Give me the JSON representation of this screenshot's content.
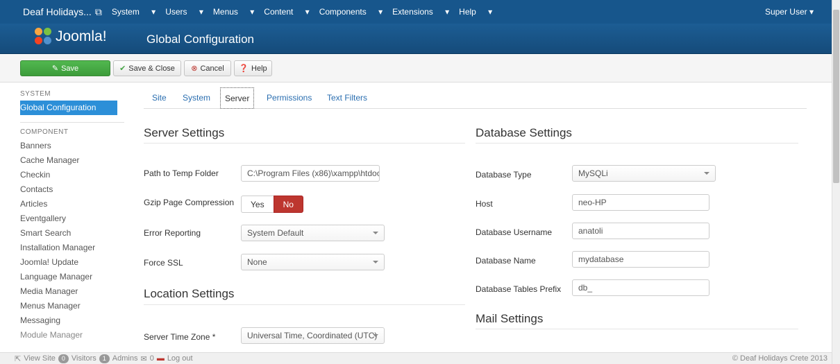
{
  "nav": {
    "site": "Deaf Holidays...",
    "menus": [
      "System",
      "Users",
      "Menus",
      "Content",
      "Components",
      "Extensions",
      "Help"
    ],
    "user": "Super User"
  },
  "header": {
    "logo_text": "Joomla!",
    "title": "Global Configuration"
  },
  "toolbar": {
    "save": "Save",
    "save_close": "Save & Close",
    "cancel": "Cancel",
    "help": "Help"
  },
  "sidebar": {
    "system_heading": "SYSTEM",
    "system_item": "Global Configuration",
    "component_heading": "COMPONENT",
    "components": [
      "Banners",
      "Cache Manager",
      "Checkin",
      "Contacts",
      "Articles",
      "Eventgallery",
      "Smart Search",
      "Installation Manager",
      "Joomla! Update",
      "Language Manager",
      "Media Manager",
      "Menus Manager",
      "Messaging",
      "Module Manager"
    ]
  },
  "tabs": [
    "Site",
    "System",
    "Server",
    "Permissions",
    "Text Filters"
  ],
  "server": {
    "heading": "Server Settings",
    "temp_label": "Path to Temp Folder",
    "temp_value": "C:\\Program Files (x86)\\xampp\\htdoc",
    "gzip_label": "Gzip Page Compression",
    "gzip_yes": "Yes",
    "gzip_no": "No",
    "error_label": "Error Reporting",
    "error_value": "System Default",
    "ssl_label": "Force SSL",
    "ssl_value": "None"
  },
  "location": {
    "heading": "Location Settings",
    "tz_label": "Server Time Zone *",
    "tz_value": "Universal Time, Coordinated (UTC)"
  },
  "database": {
    "heading": "Database Settings",
    "type_label": "Database Type",
    "type_value": "MySQLi",
    "host_label": "Host",
    "host_value": "neo-HP",
    "user_label": "Database Username",
    "user_value": "anatoli",
    "name_label": "Database Name",
    "name_value": "mydatabase",
    "prefix_label": "Database Tables Prefix",
    "prefix_value": "db_"
  },
  "mail": {
    "heading": "Mail Settings"
  },
  "status": {
    "view_site": "View Site",
    "visitors_count": "0",
    "visitors": "Visitors",
    "admins_count": "1",
    "admins": "Admins",
    "messages_count": "0",
    "logout": "Log out",
    "copyright": "© Deaf Holidays Crete 2013"
  }
}
